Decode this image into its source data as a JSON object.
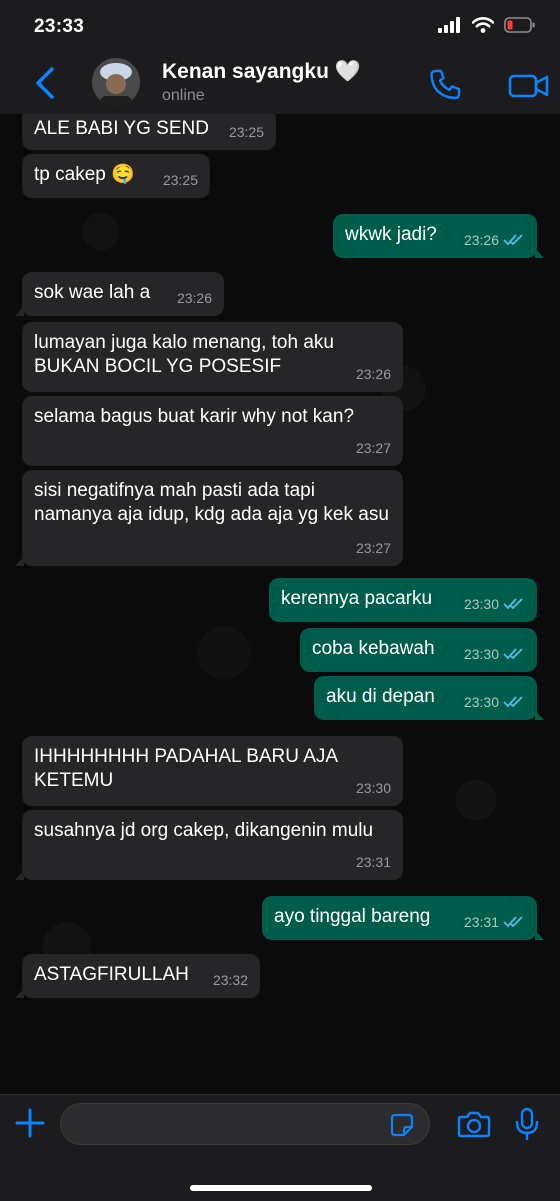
{
  "status_bar": {
    "time": "23:33"
  },
  "header": {
    "contact_name": "Kenan sayangku 🤍",
    "status": "online"
  },
  "messages": [
    {
      "dir": "in",
      "text": "ALE BABI YG SEND",
      "time": "23:25"
    },
    {
      "dir": "in",
      "text": "tp cakep 🤤",
      "time": "23:25"
    },
    {
      "dir": "out",
      "text": "wkwk jadi?",
      "time": "23:26"
    },
    {
      "dir": "in",
      "text": "sok wae lah a",
      "time": "23:26"
    },
    {
      "dir": "in",
      "text": "lumayan juga kalo menang, toh aku BUKAN BOCIL YG POSESIF",
      "time": "23:26"
    },
    {
      "dir": "in",
      "text": "selama bagus buat karir why not kan?",
      "time": "23:27"
    },
    {
      "dir": "in",
      "text": "sisi negatifnya mah pasti ada tapi namanya aja idup, kdg ada aja yg kek asu",
      "time": "23:27"
    },
    {
      "dir": "out",
      "text": "kerennya pacarku",
      "time": "23:30"
    },
    {
      "dir": "out",
      "text": "coba kebawah",
      "time": "23:30"
    },
    {
      "dir": "out",
      "text": "aku di depan",
      "time": "23:30"
    },
    {
      "dir": "in",
      "text": "IHHHHHHHH PADAHAL BARU AJA KETEMU",
      "time": "23:30"
    },
    {
      "dir": "in",
      "text": "susahnya jd org cakep, dikangenin mulu",
      "time": "23:31"
    },
    {
      "dir": "out",
      "text": "ayo tinggal bareng",
      "time": "23:31"
    },
    {
      "dir": "in",
      "text": "ASTAGFIRULLAH",
      "time": "23:32"
    }
  ],
  "composer": {
    "value": "",
    "placeholder": ""
  },
  "colors": {
    "accent": "#0a84ff",
    "incoming": "#262628",
    "outgoing": "#005c4b",
    "read_ticks": "#53bdeb",
    "battery_low": "#ff3b30"
  },
  "icons": [
    "back-chevron-icon",
    "phone-icon",
    "video-camera-icon",
    "plus-icon",
    "sticker-icon",
    "camera-icon",
    "microphone-icon",
    "double-check-icon",
    "signal-icon",
    "wifi-icon",
    "battery-icon"
  ]
}
